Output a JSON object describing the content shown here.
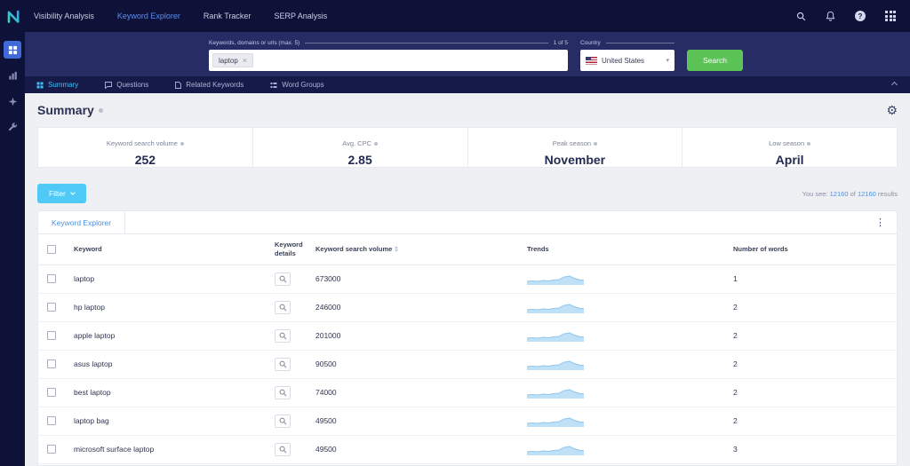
{
  "icons": {
    "gear": "⚙",
    "kebab": "⋮",
    "close": "×",
    "chevron_down": "▾",
    "help": "?"
  },
  "navbar": {
    "items": [
      {
        "label": "Visibility Analysis"
      },
      {
        "label": "Keyword Explorer"
      },
      {
        "label": "Rank Tracker"
      },
      {
        "label": "SERP Analysis"
      }
    ]
  },
  "search_panel": {
    "keywords_label": "Keywords, domains or urls (max. 5)",
    "keyword_chip": "laptop",
    "counter": "1 of 5",
    "country_label": "Country",
    "country_value": "United States",
    "search_button": "Search"
  },
  "section_tabs": [
    {
      "label": "Summary"
    },
    {
      "label": "Questions"
    },
    {
      "label": "Related Keywords"
    },
    {
      "label": "Word Groups"
    }
  ],
  "summary": {
    "title": "Summary",
    "stats": [
      {
        "label": "Keyword search volume",
        "value": "252"
      },
      {
        "label": "Avg. CPC",
        "value": "2.85"
      },
      {
        "label": "Peak season",
        "value": "November"
      },
      {
        "label": "Low season",
        "value": "April"
      }
    ]
  },
  "filter_bar": {
    "filter_label": "Filter",
    "results_prefix": "You see:",
    "results_shown": "12160",
    "results_of": "of",
    "results_total": "12160",
    "results_suffix": "results"
  },
  "panel": {
    "tab_label": "Keyword Explorer"
  },
  "table": {
    "headers": {
      "keyword": "Keyword",
      "details": "Keyword details",
      "volume": "Keyword search volume",
      "trends": "Trends",
      "words": "Number of words"
    },
    "rows": [
      {
        "keyword": "laptop",
        "volume": "673000",
        "words": "1"
      },
      {
        "keyword": "hp laptop",
        "volume": "246000",
        "words": "2"
      },
      {
        "keyword": "apple laptop",
        "volume": "201000",
        "words": "2"
      },
      {
        "keyword": "asus laptop",
        "volume": "90500",
        "words": "2"
      },
      {
        "keyword": "best laptop",
        "volume": "74000",
        "words": "2"
      },
      {
        "keyword": "laptop bag",
        "volume": "49500",
        "words": "2"
      },
      {
        "keyword": "microsoft surface laptop",
        "volume": "49500",
        "words": "3"
      }
    ]
  },
  "colors": {
    "accent_blue": "#4a90e2",
    "accent_cyan": "#3cc2f5",
    "green": "#5cc356",
    "navy_dark": "#0f1238",
    "navy_mid": "#272c64",
    "navy_tab": "#161a48"
  }
}
